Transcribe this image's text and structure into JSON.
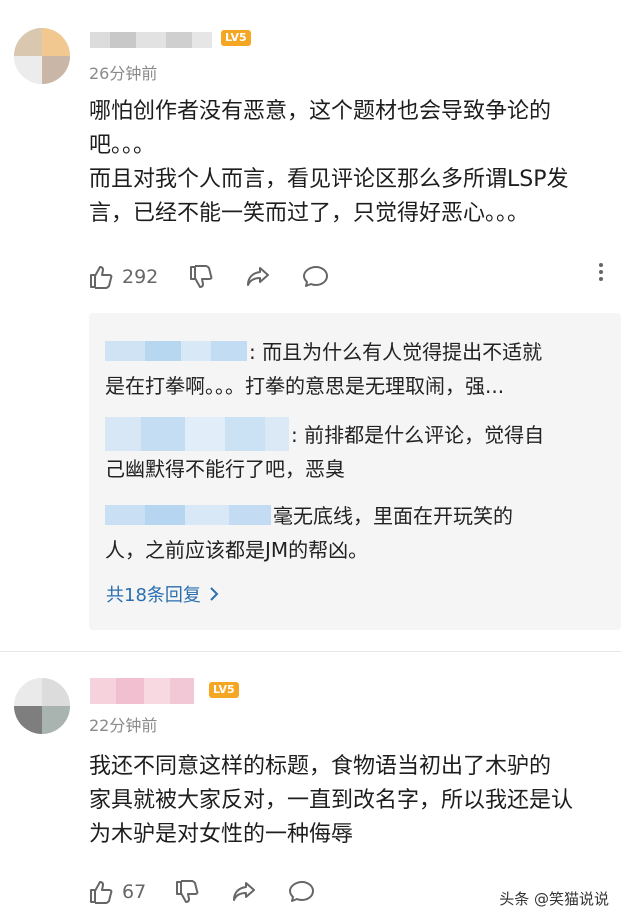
{
  "comments": [
    {
      "level": "LV5",
      "time": "26分钟前",
      "lines": [
        "哪怕创作者没有恶意，这个题材也会导致争论的",
        "吧。。。",
        "而且对我个人而言，看见评论区那么多所谓LSP发",
        "言，已经不能一笑而过了，只觉得好恶心。。。"
      ],
      "likes": "292",
      "replies": [
        {
          "text_line1": ": 而且为什么有人觉得提出不适就",
          "text_line2": "是在打拳啊。。。打拳的意思是无理取闹，强..."
        },
        {
          "text_line1": ": 前排都是什么评论，觉得自",
          "text_line2": "己幽默得不能行了吧，恶臭"
        },
        {
          "text_line1": "毫无底线，里面在开玩笑的",
          "text_line2": "人，之前应该都是JM的帮凶。"
        }
      ],
      "view_more": "共18条回复"
    },
    {
      "level": "LV5",
      "time": "22分钟前",
      "lines": [
        "我还不同意这样的标题，食物语当初出了木驴的",
        "家具就被大家反对，一直到改名字，所以我还是认",
        "为木驴是对女性的一种侮辱"
      ],
      "likes": "67"
    }
  ],
  "watermark": "头条 @笑猫说说",
  "colors": {
    "level_badge": "#f5a623",
    "link": "#2a6fb0",
    "reply_bg": "#f5f5f5"
  },
  "icons": [
    "thumbs-up-icon",
    "thumbs-down-icon",
    "share-icon",
    "comment-icon",
    "more-icon",
    "chevron-right-icon"
  ]
}
